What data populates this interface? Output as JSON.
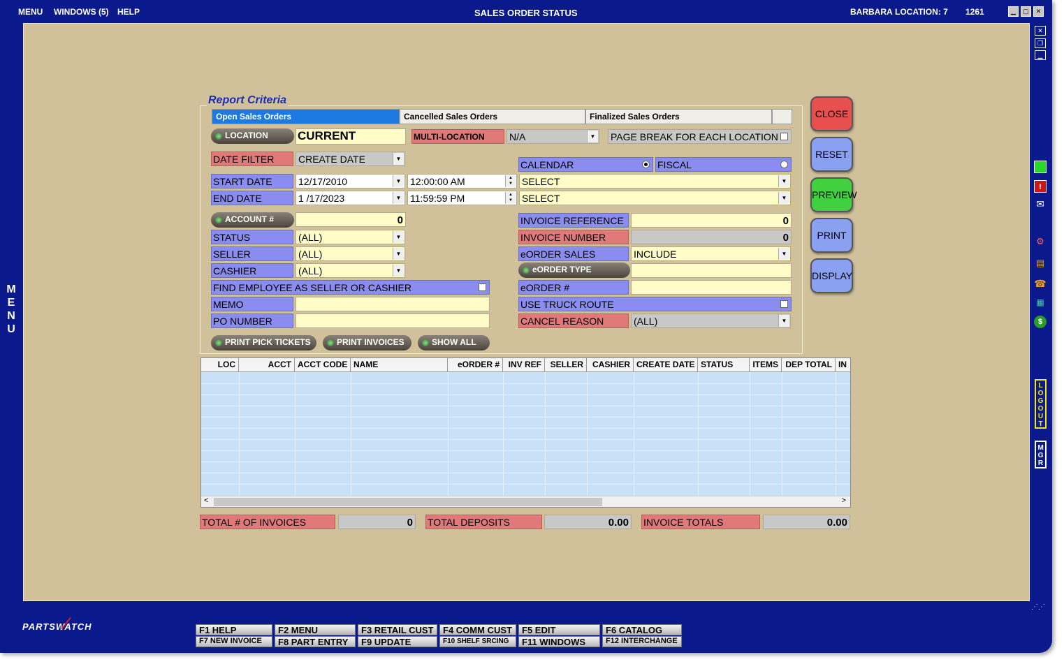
{
  "menubar": {
    "menu": "MENU",
    "windows": "WINDOWS (5)",
    "help": "HELP"
  },
  "window": {
    "title": "SALES ORDER STATUS",
    "user": "BARBARA",
    "location": "LOCATION: 7",
    "id": "1261"
  },
  "side_menu_label": [
    "M",
    "E",
    "N",
    "U"
  ],
  "report": {
    "legend": "Report Criteria",
    "tabs": [
      "Open Sales Orders",
      "Cancelled Sales Orders",
      "Finalized Sales Orders"
    ],
    "location_btn": "LOCATION",
    "location_value": "CURRENT",
    "multi_location_label": "MULTI-LOCATION",
    "multi_location_value": "N/A",
    "page_break_label": "PAGE BREAK FOR EACH LOCATION",
    "date_filter_label": "DATE FILTER",
    "date_filter_value": "CREATE DATE",
    "calendar_label": "CALENDAR",
    "fiscal_label": "FISCAL",
    "start_date_label": "START DATE",
    "start_date": "12/17/2010",
    "start_time": "12:00:00 AM",
    "start_select": "SELECT",
    "end_date_label": "END DATE",
    "end_date": "1 /17/2023",
    "end_time": "11:59:59 PM",
    "end_select": "SELECT",
    "account_btn": "ACCOUNT #",
    "account_value": "0",
    "invoice_reference_label": "INVOICE REFERENCE",
    "invoice_reference_value": "0",
    "status_label": "STATUS",
    "status_value": "(ALL)",
    "invoice_number_label": "INVOICE NUMBER",
    "invoice_number_value": "0",
    "seller_label": "SELLER",
    "seller_value": "(ALL)",
    "eorder_sales_label": "eORDER SALES",
    "eorder_sales_value": "INCLUDE",
    "cashier_label": "CASHIER",
    "cashier_value": "(ALL)",
    "eorder_type_btn": "eORDER TYPE",
    "find_employee_label": "FIND EMPLOYEE AS SELLER OR CASHIER",
    "eorder_num_label": "eORDER #",
    "memo_label": "MEMO",
    "use_truck_route_label": "USE TRUCK ROUTE",
    "po_number_label": "PO NUMBER",
    "cancel_reason_label": "CANCEL REASON",
    "cancel_reason_value": "(ALL)",
    "print_pick_tickets": "PRINT PICK TICKETS",
    "print_invoices": "PRINT INVOICES",
    "show_all": "SHOW ALL"
  },
  "actions": {
    "close": "CLOSE",
    "reset": "RESET",
    "preview": "PREVIEW",
    "print": "PRINT",
    "display": "DISPLAY"
  },
  "action_colors": {
    "close": "#e85050",
    "reset": "#8aa0f0",
    "preview": "#40d040",
    "print": "#8aa0f0",
    "display": "#8aa0f0"
  },
  "table": {
    "columns": [
      "LOC",
      "ACCT",
      "ACCT CODE",
      "NAME",
      "eORDER #",
      "INV REF",
      "SELLER",
      "CASHIER",
      "CREATE DATE",
      "STATUS",
      "ITEMS",
      "DEP TOTAL",
      "IN"
    ]
  },
  "totals": {
    "invoices_label": "TOTAL # OF INVOICES",
    "invoices_value": "0",
    "deposits_label": "TOTAL DEPOSITS",
    "deposits_value": "0.00",
    "invoice_totals_label": "INVOICE TOTALS",
    "invoice_totals_value": "0.00"
  },
  "logo": "PARTSWATCH",
  "side_tabs": {
    "logout": "LOGOUT",
    "mgr": "MGR"
  },
  "fkeys": {
    "row1": [
      "F1 HELP",
      "F2 MENU",
      "F3 RETAIL CUST",
      "F4 COMM CUST",
      "F5 EDIT",
      "F6 CATALOG"
    ],
    "row2": [
      "F7 NEW INVOICE",
      "F8 PART ENTRY",
      "F9 UPDATE",
      "F10 SHELF SRCING",
      "F11 WINDOWS",
      "F12 INTERCHANGE"
    ]
  }
}
